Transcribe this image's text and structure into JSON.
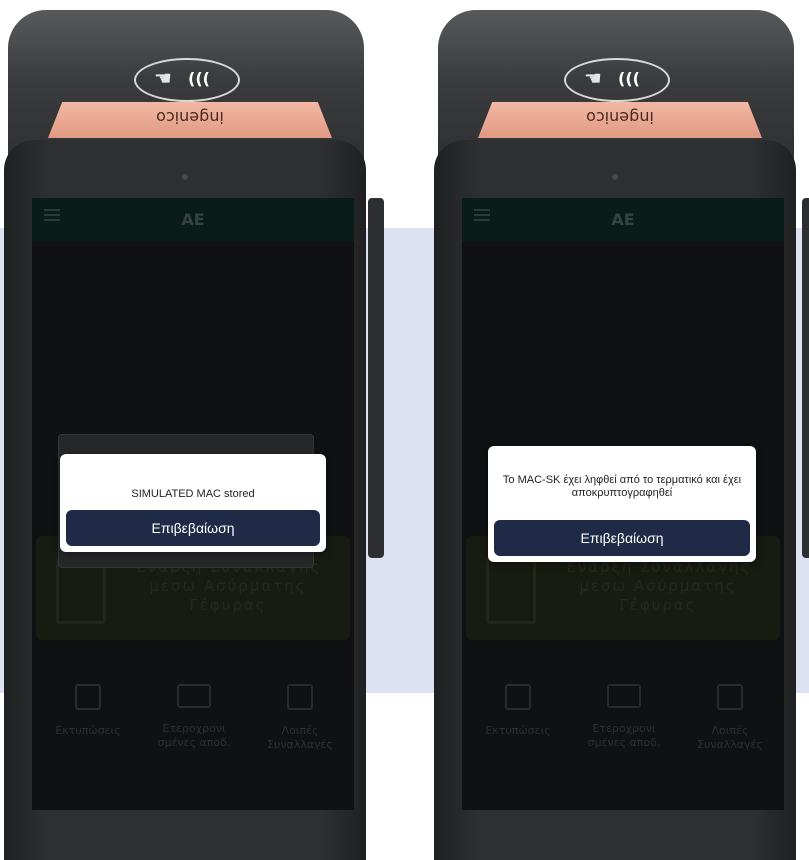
{
  "devices": [
    {
      "brand": "ingenico",
      "appbar_title": "AE",
      "wireless_card_text": "Έναρξη Συναλλαγής μέσω Ασύρματης Γέφυρας",
      "shortcuts": [
        {
          "label": "Εκτυπώσεις",
          "icon": "printer-icon"
        },
        {
          "label": "Ετεροχρονι σμένες αποδ.",
          "icon": "card-icon"
        },
        {
          "label": "Λοιπές Συναλλαγές",
          "icon": "edit-icon"
        }
      ],
      "dialog": {
        "message": "SIMULATED MAC stored",
        "button": "Επιβεβαίωση"
      }
    },
    {
      "brand": "ingenico",
      "appbar_title": "AE",
      "wireless_card_text": "Έναρξη Συναλλαγής μέσω Ασύρματης Γέφυρας",
      "shortcuts": [
        {
          "label": "Εκτυπώσεις",
          "icon": "printer-icon"
        },
        {
          "label": "Ετεροχρονι σμένες αποδ.",
          "icon": "card-icon"
        },
        {
          "label": "Λοιπές Συναλλαγές",
          "icon": "edit-icon"
        }
      ],
      "dialog": {
        "message": "Το MAC-SK έχει ληφθεί από το τερματικό και έχει αποκρυπτογραφηθεί",
        "button": "Επιβεβαίωση"
      }
    }
  ],
  "colors": {
    "accent": "#1f2a47",
    "appbar": "#0f3330",
    "background_band": "#dde2f3"
  }
}
